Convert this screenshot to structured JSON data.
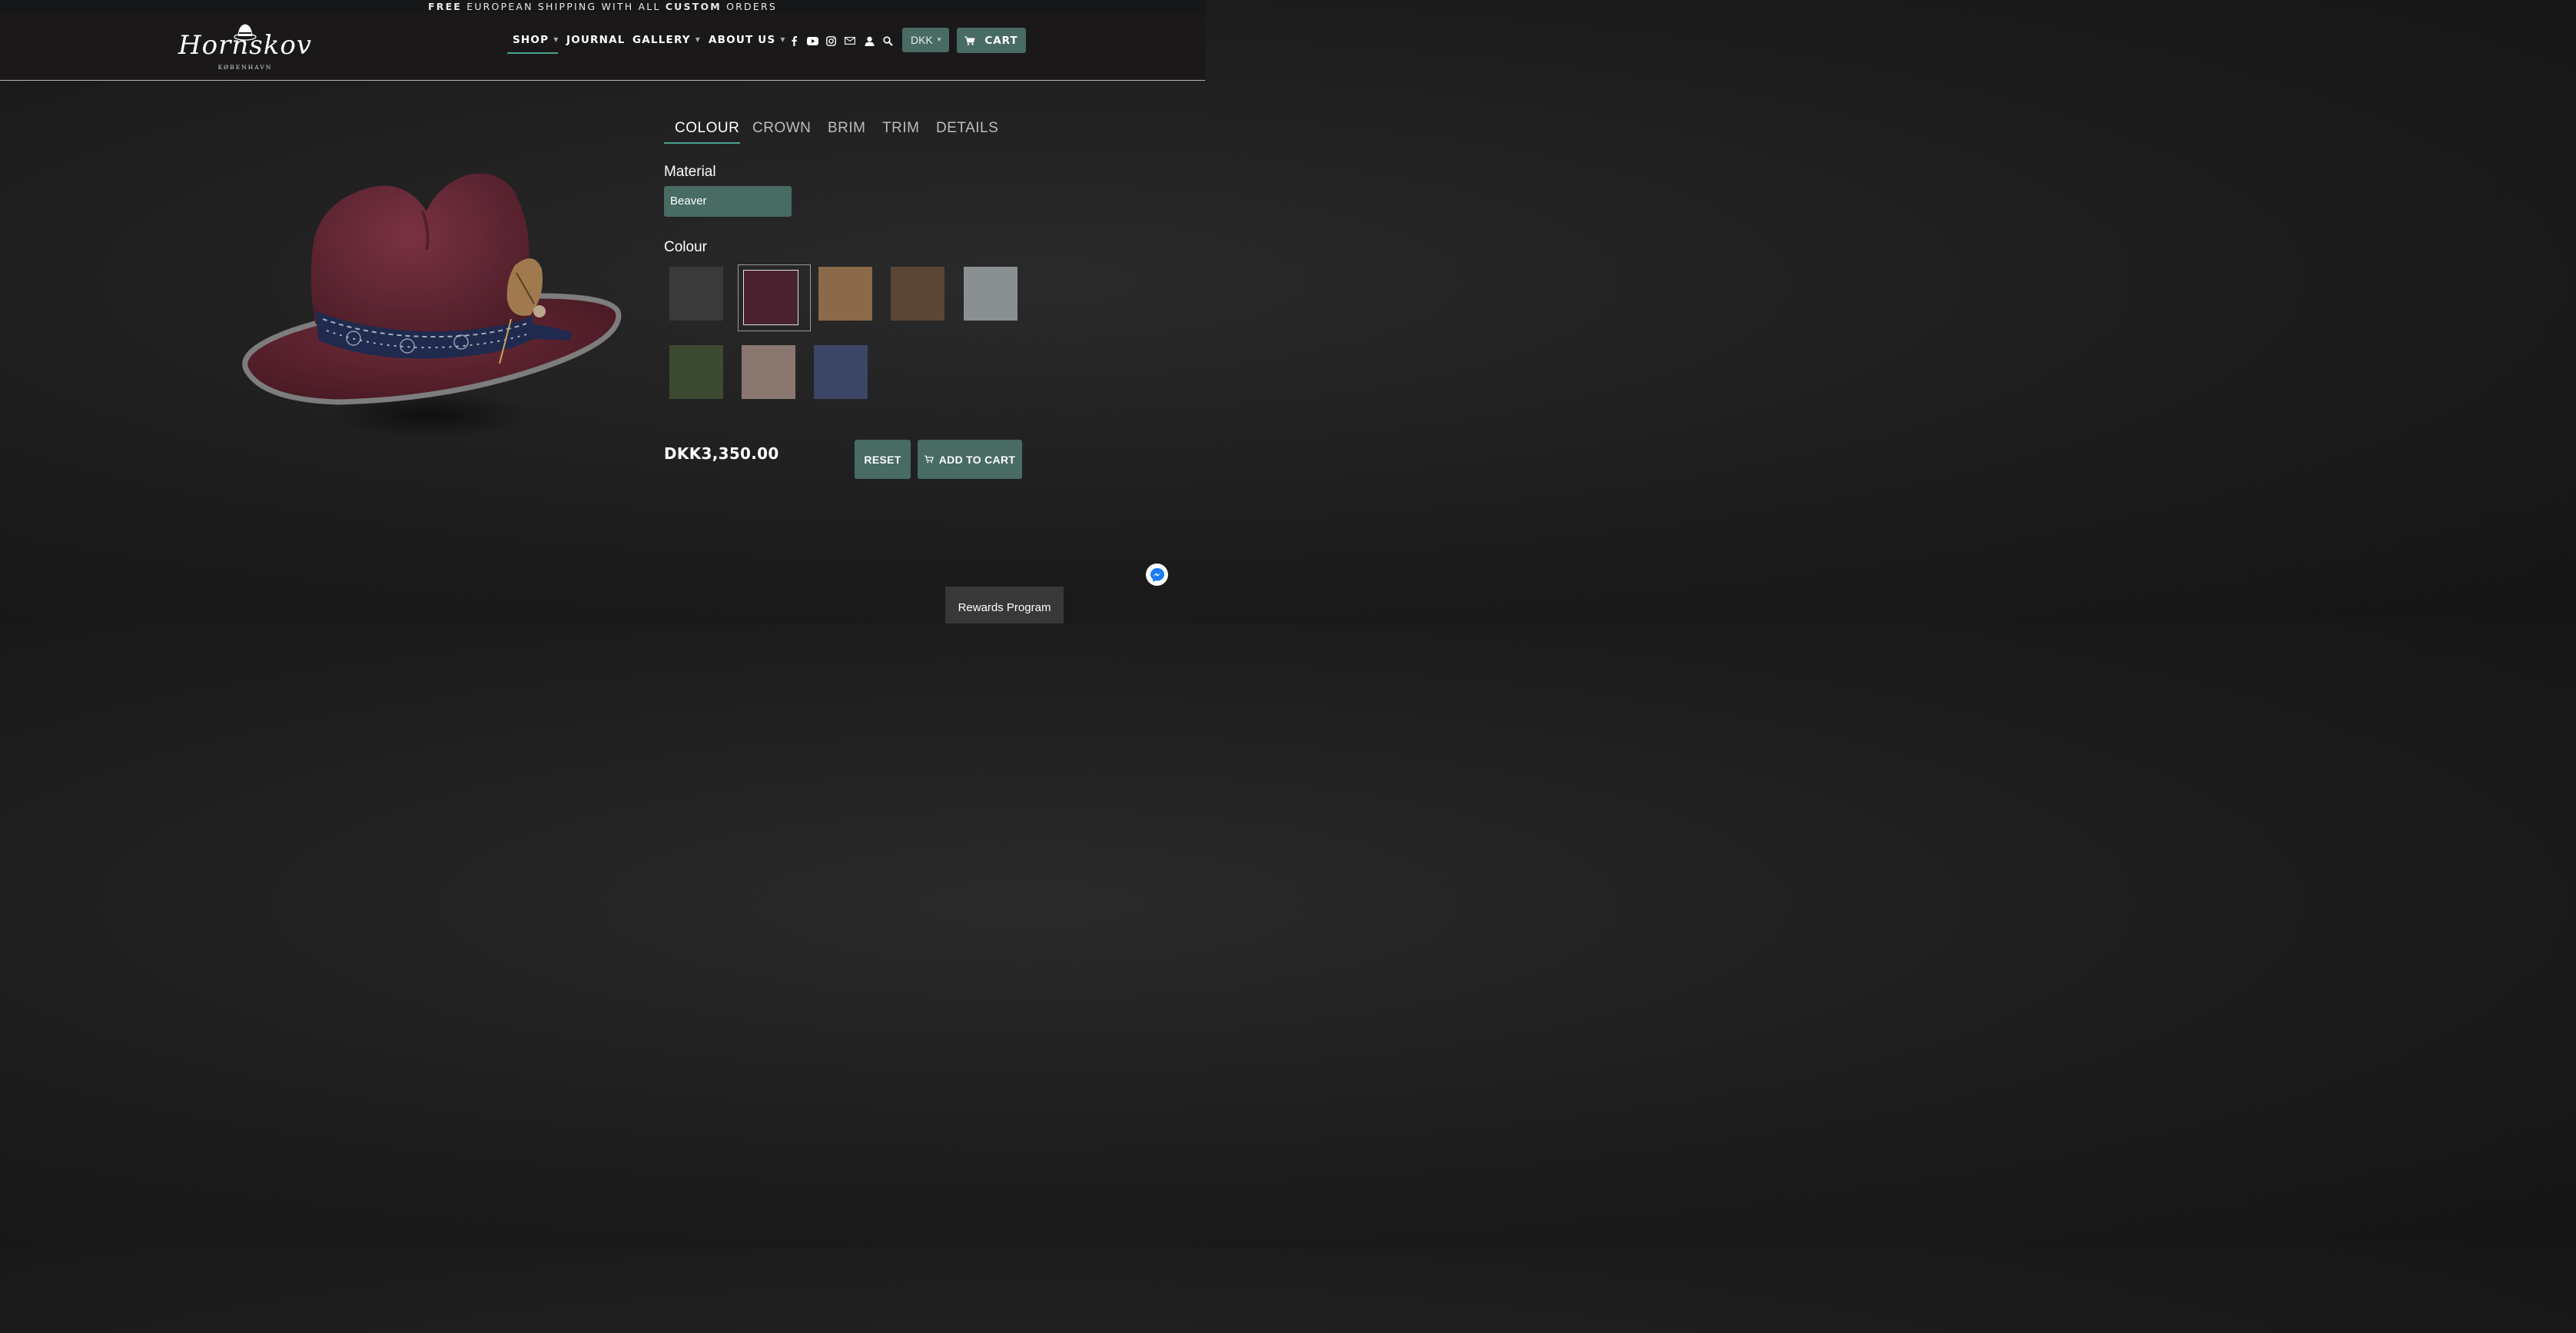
{
  "announcement": {
    "part1": "FREE",
    "part2": " EUROPEAN SHIPPING WITH ALL ",
    "part3": "CUSTOM",
    "part4": " ORDERS"
  },
  "brand": {
    "logo_text": "Hornskov",
    "logo_subtext": "KØBENHAVN"
  },
  "nav": {
    "shop": "SHOP",
    "journal": "JOURNAL",
    "gallery": "GALLERY",
    "about": "ABOUT US",
    "icons": [
      "facebook-icon",
      "youtube-icon",
      "instagram-icon",
      "mail-icon",
      "user-icon",
      "search-icon"
    ],
    "currency": "DKK",
    "cart_label": "CART"
  },
  "configurator": {
    "tabs": [
      "COLOUR",
      "CROWN",
      "BRIM",
      "TRIM",
      "DETAILS"
    ],
    "active_tab": "COLOUR",
    "material_label": "Material",
    "material_value": "Beaver",
    "colour_label": "Colour",
    "swatches": [
      {
        "color": "#3a3a3a",
        "selected": false
      },
      {
        "color": "#4a2230",
        "selected": true
      },
      {
        "color": "#8a6a48",
        "selected": false
      },
      {
        "color": "#5b4636",
        "selected": false
      },
      {
        "color": "#8a9091",
        "selected": false
      },
      {
        "color": "#3d4a32",
        "selected": false
      },
      {
        "color": "#8a7770",
        "selected": false
      },
      {
        "color": "#3d4566",
        "selected": false
      }
    ],
    "price": "DKK3,350.00",
    "reset_label": "RESET",
    "add_to_cart_label": "ADD TO CART"
  },
  "widgets": {
    "rewards_label": "Rewards Program"
  },
  "colors": {
    "accent": "#486b64",
    "underline": "#4aa190",
    "hat_felt": "#6b2a36"
  }
}
